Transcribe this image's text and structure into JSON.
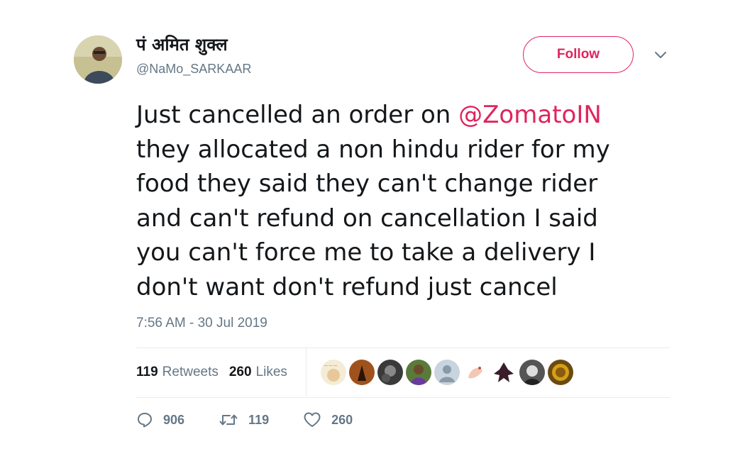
{
  "author": {
    "name": "पं अमित शुक्ल",
    "handle": "@NaMo_SARKAAR"
  },
  "follow_label": "Follow",
  "tweet": {
    "lines": [
      {
        "pre": "Just cancelled an order on ",
        "mention": "@ZomatoIN"
      },
      {
        "pre": "they allocated a non hindu rider for my"
      },
      {
        "pre": "food they said they can't change rider"
      },
      {
        "pre": "and can't refund on cancellation I said"
      },
      {
        "pre": "you can't force me to take a delivery I"
      },
      {
        "pre": "don't want don't refund just cancel"
      }
    ]
  },
  "timestamp": "7:56 AM - 30 Jul 2019",
  "stats": {
    "retweets_count": "119",
    "retweets_label": "Retweets",
    "likes_count": "260",
    "likes_label": "Likes"
  },
  "actions": {
    "replies": "906",
    "retweets": "119",
    "likes": "260"
  },
  "colors": {
    "accent": "#e0245e",
    "secondary_text": "#657786",
    "divider": "#e6ecf0"
  },
  "icons": {
    "reply": "reply-icon",
    "retweet": "retweet-icon",
    "like": "heart-icon",
    "more": "chevron-down-icon"
  }
}
